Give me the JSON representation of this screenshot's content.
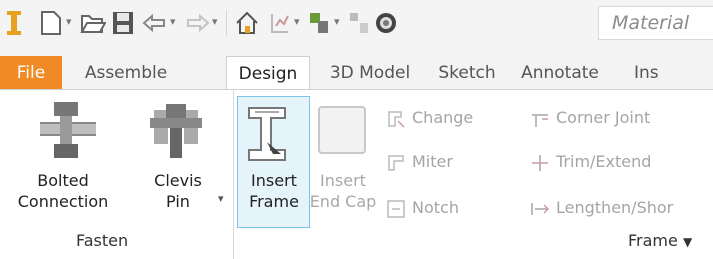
{
  "quick_access": {
    "material_value": "Material"
  },
  "tabs": [
    {
      "label": "File"
    },
    {
      "label": "Assemble"
    },
    {
      "label": "Design"
    },
    {
      "label": "3D Model"
    },
    {
      "label": "Sketch"
    },
    {
      "label": "Annotate"
    },
    {
      "label": "Ins"
    }
  ],
  "ribbon": {
    "fasten": {
      "title": "Fasten",
      "bolted_connection": {
        "line1": "Bolted",
        "line2": "Connection"
      },
      "clevis_pin": {
        "line1": "Clevis",
        "line2": "Pin"
      }
    },
    "frame": {
      "title": "Frame",
      "insert_frame": {
        "line1": "Insert",
        "line2": "Frame"
      },
      "insert_end_cap": {
        "line1": "Insert",
        "line2": "End Cap"
      },
      "change": "Change",
      "miter": "Miter",
      "notch": "Notch",
      "corner_joint": "Corner Joint",
      "trim_extend": "Trim/Extend",
      "lengthen_shorten": "Lengthen/Shor"
    }
  },
  "colors": {
    "file_tab": "#f08a24",
    "selection_border": "#7ec3e8",
    "disabled_text": "#a5a5a5"
  }
}
